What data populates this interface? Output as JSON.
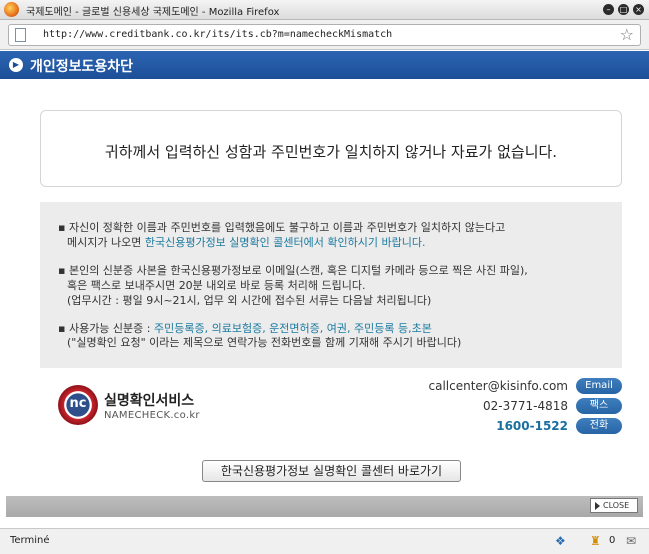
{
  "window": {
    "title": "국제도메인 - 글로벌 신용세상 국제도메인 - Mozilla Firefox",
    "url": "http://www.creditbank.co.kr/its/its.cb?m=namecheckMismatch"
  },
  "header": {
    "title": "개인정보도용차단"
  },
  "message": "귀하께서 입력하신 성함과 주민번호가 일치하지 않거나 자료가 없습니다.",
  "info": {
    "p1_line1": "▪ 자신이 정확한 이름과 주민번호를 입력했음에도 불구하고 이름과 주민번호가 일치하지 않는다고",
    "p1_line2_plain": "메시지가 나오면 ",
    "p1_line2_hl": "한국신용평가정보 실명확인 콜센터에서 확인하시기 바랍니다.",
    "p2_line1": "▪ 본인의 신분증 사본을 한국신용평가정보로 이메일(스캔, 혹은 디지털 카메라 등으로 찍은 사진 파일),",
    "p2_line2": "혹은 팩스로 보내주시면 20분 내외로 바로 등록 처리해 드립니다.",
    "p2_line3": "(업무시간 : 평일 9시~21시, 업무 외 시간에 접수된 서류는 다음날 처리됩니다)",
    "p3_line1_plain": "▪ 사용가능 신분증 : ",
    "p3_line1_hl": "주민등록증, 의료보험증, 운전면허증, 여권, 주민등록 등,초본",
    "p3_line2": "(\"실명확인 요청\" 이라는 제목으로 연락가능 전화번호를 함께 기재해 주시기 바랍니다)"
  },
  "logo": {
    "icon_text": "nc",
    "name_kr": "실명확인서비스",
    "name_en": "NAMECHECK.co.kr"
  },
  "contact": {
    "email": "callcenter@kisinfo.com",
    "email_label": "Email",
    "fax": "02-3771-4818",
    "fax_label": "팩스",
    "phone": "1600-1522",
    "phone_label": "전화"
  },
  "link_button": "한국신용평가정보 실명확인 콜센터 바로가기",
  "close_button": "CLOSE",
  "status": {
    "text": "Terminé",
    "count": "0"
  }
}
